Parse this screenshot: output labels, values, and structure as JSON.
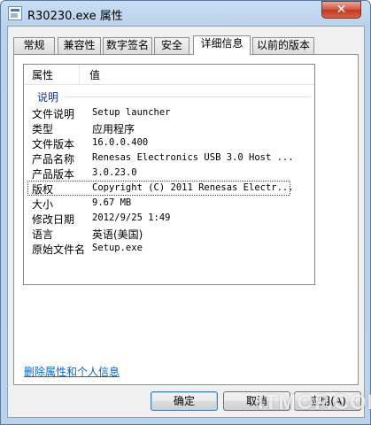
{
  "window": {
    "title": "R30230.exe 属性",
    "close_glyph": "✕"
  },
  "tabs": [
    "常规",
    "兼容性",
    "数字签名",
    "安全",
    "详细信息",
    "以前的版本"
  ],
  "details": {
    "col_property": "属性",
    "col_value": "值",
    "group_label": "说明",
    "rows": [
      {
        "key": "文件说明",
        "value": "Setup launcher"
      },
      {
        "key": "类型",
        "value": "应用程序"
      },
      {
        "key": "文件版本",
        "value": "16.0.0.400"
      },
      {
        "key": "产品名称",
        "value": "Renesas Electronics USB 3.0 Host ..."
      },
      {
        "key": "产品版本",
        "value": "3.0.23.0"
      },
      {
        "key": "版权",
        "value": "Copyright (C) 2011 Renesas Electr..."
      },
      {
        "key": "大小",
        "value": "9.67 MB"
      },
      {
        "key": "修改日期",
        "value": "2012/9/25 1:49"
      },
      {
        "key": "语言",
        "value": "英语(美国)"
      },
      {
        "key": "原始文件名",
        "value": "Setup.exe"
      }
    ]
  },
  "remove_link": "删除属性和个人信息",
  "buttons": {
    "ok": "确定",
    "cancel": "取消",
    "apply": "应用(A)"
  },
  "watermark": "ITMOP.COM"
}
